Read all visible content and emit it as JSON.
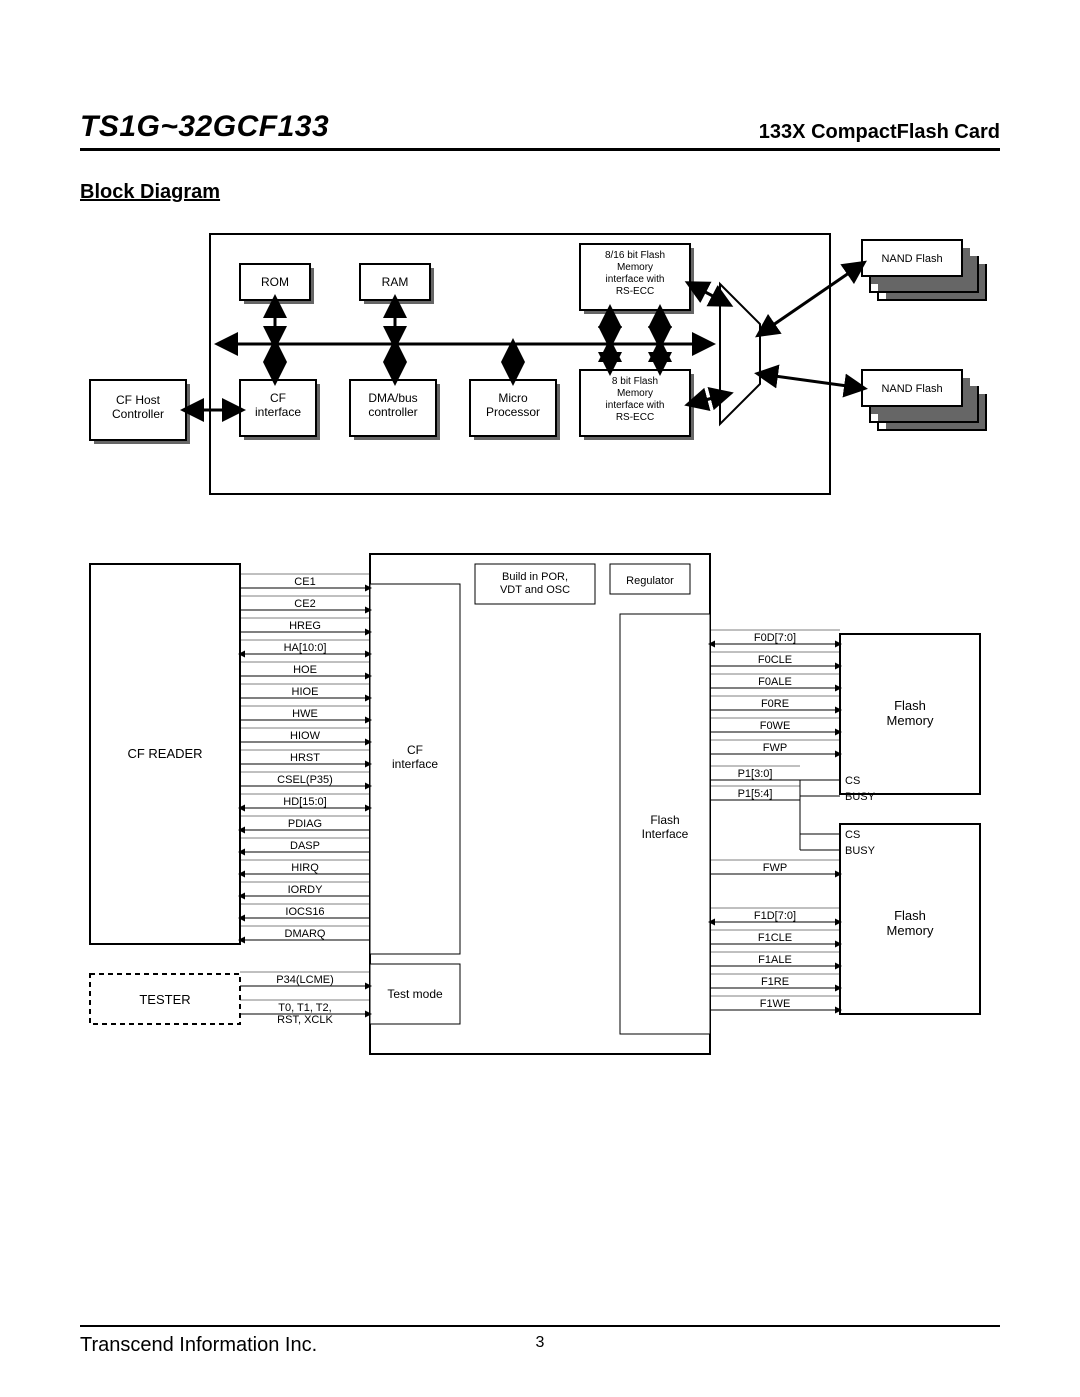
{
  "header": {
    "model": "TS1G~32GCF133",
    "product": "133X CompactFlash Card"
  },
  "section_title": "Block Diagram",
  "footer": {
    "company": "Transcend Information Inc.",
    "page": "3"
  },
  "diagram1": {
    "blocks": {
      "rom": "ROM",
      "ram": "RAM",
      "fi16": "8/16 bit Flash\nMemory\ninterface with\nRS-ECC",
      "nand1": "NAND Flash",
      "nand2": "NAND Flash",
      "cfhost": "CF Host\nController",
      "cfif": "CF\ninterface",
      "dma": "DMA/bus\ncontroller",
      "micro": "Micro\nProcessor",
      "fi8": "8 bit Flash\nMemory\ninterface with\nRS-ECC"
    }
  },
  "diagram2": {
    "cf_reader": "CF READER",
    "tester": "TESTER",
    "cf_if": "CF\ninterface",
    "test_mode": "Test mode",
    "por": "Build in POR,\nVDT and OSC",
    "reg": "Regulator",
    "flash_if": "Flash\nInterface",
    "flash_mem1": "Flash\nMemory",
    "flash_mem2": "Flash\nMemory",
    "left_signals": [
      "CE1",
      "CE2",
      "HREG",
      "HA[10:0]",
      "HOE",
      "HIOE",
      "HWE",
      "HIOW",
      "HRST",
      "CSEL(P35)",
      "HD[15:0]",
      "PDIAG",
      "DASP",
      "HIRQ",
      "IORDY",
      "IOCS16",
      "DMARQ"
    ],
    "tester_signals": [
      "P34(LCME)",
      "T0, T1, T2,\nRST, XCLK"
    ],
    "right_top": [
      "F0D[7:0]",
      "F0CLE",
      "F0ALE",
      "F0RE",
      "F0WE",
      "FWP"
    ],
    "p1": [
      "P1[3:0]",
      "P1[5:4]"
    ],
    "cs_busy": [
      "CS",
      "BUSY"
    ],
    "right_mid": [
      "FWP"
    ],
    "right_bot": [
      "F1D[7:0]",
      "F1CLE",
      "F1ALE",
      "F1RE",
      "F1WE"
    ]
  }
}
